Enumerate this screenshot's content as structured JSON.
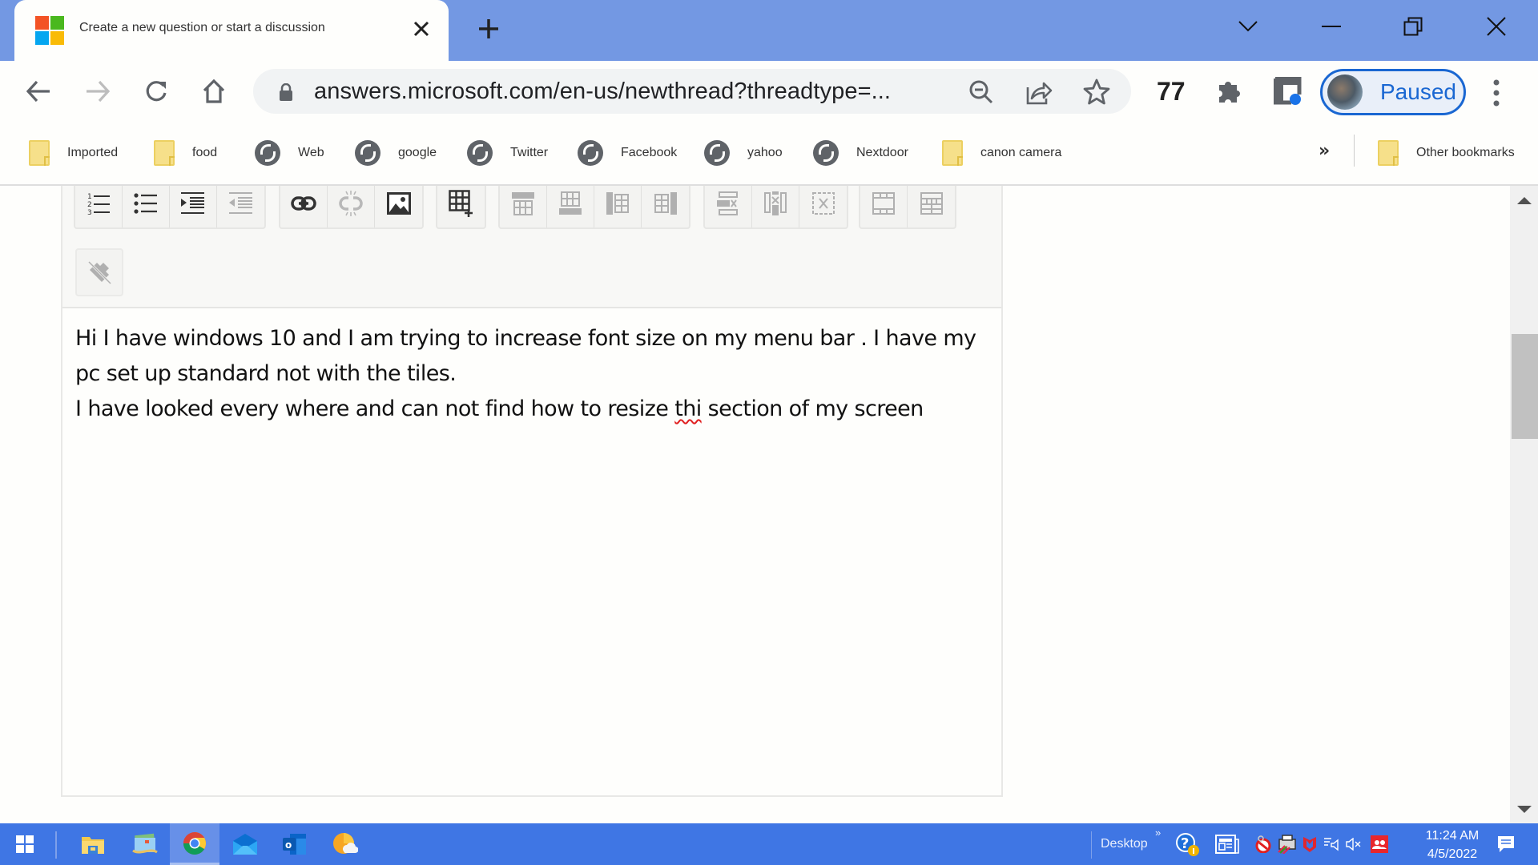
{
  "browser": {
    "tab": {
      "title": "Create a new question or start a discussion",
      "favicon": "microsoft-logo",
      "close_icon": "close-icon"
    },
    "new_tab_icon": "plus-icon",
    "window_controls": [
      "tab-search-chevron-icon",
      "minimize-icon",
      "restore-icon",
      "close-icon"
    ],
    "nav": {
      "back_icon": "arrow-left-icon",
      "forward_icon": "arrow-right-icon",
      "reload_icon": "reload-icon",
      "home_icon": "home-icon"
    },
    "omnibox": {
      "url": "answers.microsoft.com/en-us/newthread?threadtype=...",
      "icons": [
        "lock-icon",
        "zoom-out-icon",
        "share-icon",
        "star-icon"
      ]
    },
    "extension_count": "77",
    "profile": {
      "label": "Paused"
    },
    "colors": {
      "tab_strip": "#7398e3",
      "profile_accent": "#1a67d2",
      "taskbar": "#3f76e4"
    }
  },
  "bookmarks": {
    "items": [
      {
        "label": "Imported",
        "icon": "folder-icon"
      },
      {
        "label": "food",
        "icon": "folder-icon"
      },
      {
        "label": "Web",
        "icon": "globe-icon"
      },
      {
        "label": "google",
        "icon": "globe-icon"
      },
      {
        "label": "Twitter",
        "icon": "globe-icon"
      },
      {
        "label": "Facebook",
        "icon": "globe-icon"
      },
      {
        "label": "yahoo",
        "icon": "globe-icon"
      },
      {
        "label": "Nextdoor",
        "icon": "globe-icon"
      },
      {
        "label": "canon camera",
        "icon": "folder-icon"
      }
    ],
    "overflow": "»",
    "other": "Other bookmarks"
  },
  "editor": {
    "toolbar_groups": [
      [
        "numbered-list",
        "bulleted-list",
        "indent",
        "outdent"
      ],
      [
        "insert-link",
        "unlink",
        "insert-image"
      ],
      [
        "insert-table"
      ],
      [
        "insert-row-above",
        "insert-row-below",
        "insert-column-left",
        "insert-column-right"
      ],
      [
        "delete-row",
        "delete-column",
        "delete-table"
      ],
      [
        "table-header",
        "table-properties"
      ]
    ],
    "row2_button": "remove-formatting",
    "paragraphs": [
      "Hi I have windows 10 and I am trying to increase font size on my menu bar  .  I have my pc set up standard not with the tiles.",
      "I have looked every where and can not find how to resize "
    ],
    "misspelled_word": "thi",
    "paragraph2_tail": " section of my screen"
  },
  "taskbar": {
    "apps": [
      "windows-start",
      "file-explorer",
      "mail-app-classic",
      "chrome",
      "mail",
      "outlook",
      "weather"
    ],
    "desktop_label": "Desktop",
    "overflow": "»",
    "time": "11:24 AM",
    "date": "4/5/2022"
  }
}
